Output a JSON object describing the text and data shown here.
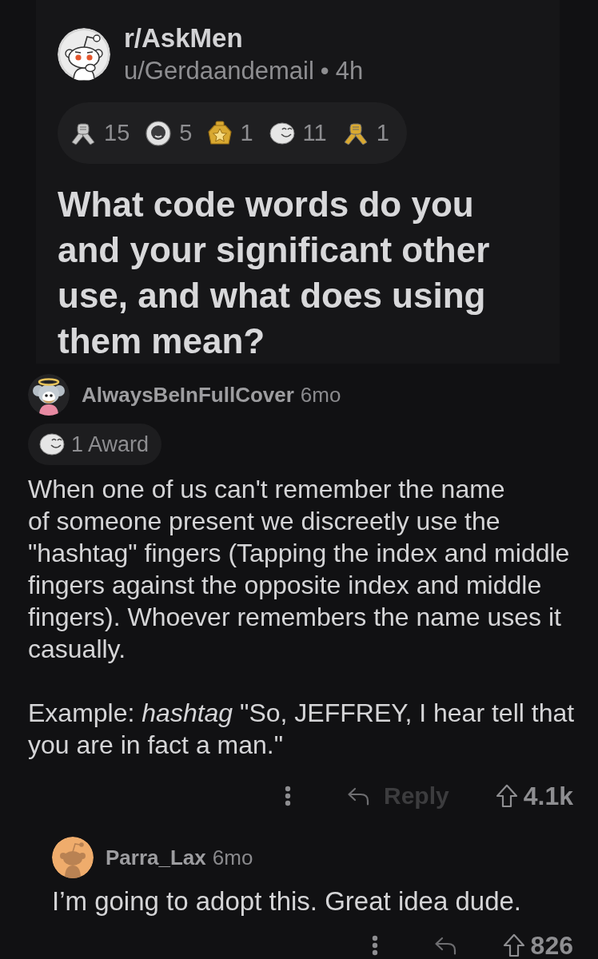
{
  "post": {
    "subreddit": "r/AskMen",
    "author": "u/Gerdaandemail",
    "separator": "•",
    "age": "4h",
    "awards": [
      {
        "kind": "handshake",
        "color": "#c9c9c9",
        "count": "15"
      },
      {
        "kind": "coin",
        "color": "#e2e2e2",
        "count": "5"
      },
      {
        "kind": "medal",
        "color": "#d9a931",
        "count": "1"
      },
      {
        "kind": "face",
        "color": "#e6e6e6",
        "count": "11"
      },
      {
        "kind": "handshake",
        "color": "#d9a931",
        "count": "1"
      }
    ],
    "title": "What code words do you and your significant other use, and what does using them mean?"
  },
  "comments": [
    {
      "avatar": {
        "kind": "costume"
      },
      "author": "AlwaysBeInFullCover",
      "age": "6mo",
      "award": {
        "kind": "face",
        "label": "1 Award"
      },
      "paragraphs": [
        "When one of us can't remember the name\nof someone present we discreetly use the \"hashtag\" fingers (Tapping the index and middle fingers against the opposite index and middle fingers). Whoever remembers the name uses it casually.",
        "Example: *hashtag* \"So, JEFFREY, I hear tell that you are in fact a man.\""
      ],
      "actions": {
        "reply_label": "Reply",
        "score": "4.1k"
      },
      "children": [
        {
          "avatar": {
            "kind": "plain"
          },
          "author": "Parra_Lax",
          "age": "6mo",
          "paragraphs": [
            "I’m going to adopt this. Great idea dude."
          ],
          "actions": {
            "score": "826"
          }
        }
      ]
    }
  ]
}
